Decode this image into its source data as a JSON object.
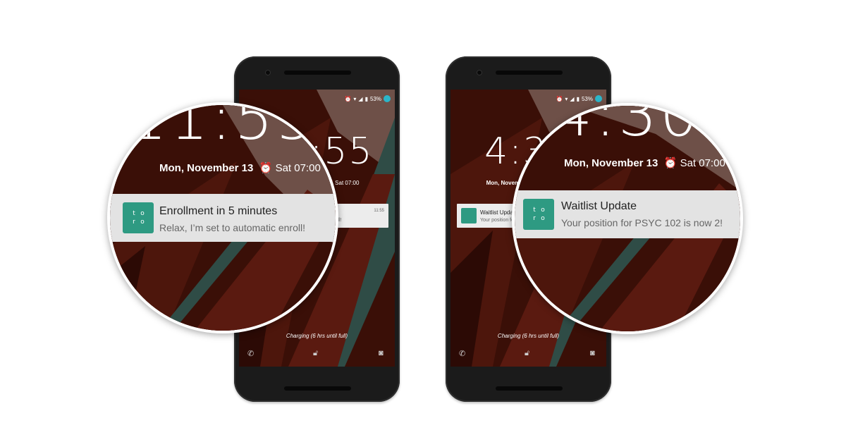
{
  "left_phone": {
    "status": {
      "battery": "53%"
    },
    "time": "11:55",
    "date": "Mon, November 13",
    "alarm": "Sat 07:00",
    "notification": {
      "app_logo": "toro",
      "title": "Enrollment in 5 minutes",
      "body": "Relax, I’m set to automatic enroll!",
      "time": "11:55",
      "body_small": "enroll!"
    },
    "charging": "Charging (6 hrs until full)",
    "icons": [
      "phone-icon",
      "lock-icon",
      "camera-icon"
    ]
  },
  "right_phone": {
    "status": {
      "battery": "53%"
    },
    "time": "4:30",
    "date": "Mon, November 13",
    "alarm": "Sat 07:00",
    "notification": {
      "app_logo": "toro",
      "title": "Waitlist Update",
      "body": "Your position for PSYC 102 is now 2!",
      "title_small": "Waitlist Up",
      "body_small": "Your positio"
    },
    "charging": "Charging (6 hrs until full)",
    "icons": [
      "phone-icon",
      "lock-icon",
      "camera-icon"
    ]
  },
  "colors": {
    "wallpaper_dark": "#3a0f07",
    "wallpaper_red": "#5a1a10",
    "wallpaper_teal": "#2f4c46",
    "accent_teal": "#2e9a82",
    "avatar": "#2bb5c9"
  }
}
